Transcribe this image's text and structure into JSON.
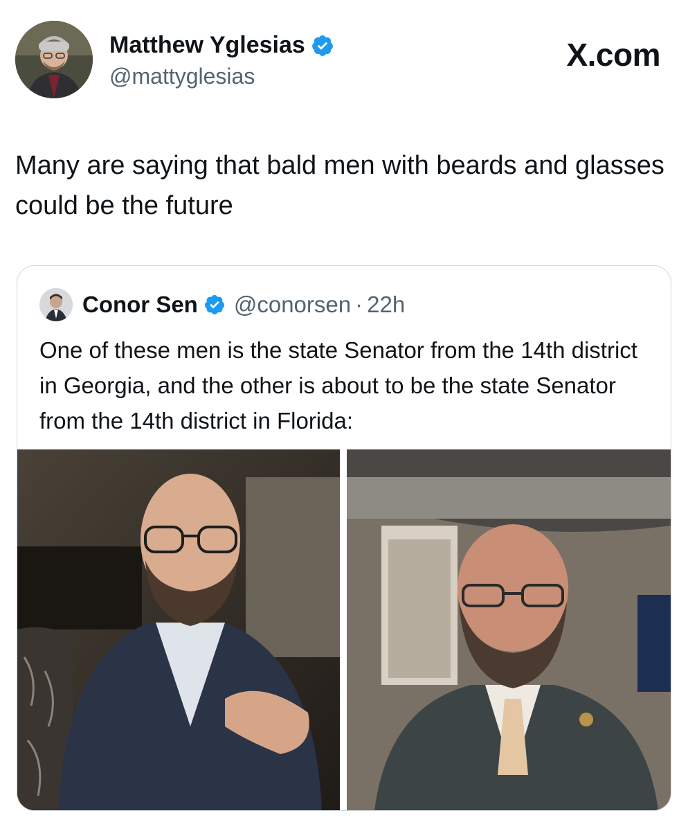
{
  "author": {
    "name": "Matthew Yglesias",
    "handle": "@mattyglesias",
    "verified_icon": "verified-badge-icon"
  },
  "brand": "X.com",
  "tweet_text": "Many are saying that bald men with beards and glasses could be the future",
  "quoted": {
    "name": "Conor Sen",
    "handle": "@conorsen",
    "separator": "·",
    "time": "22h",
    "text": "One of these men is the state Senator from the 14th district in Georgia, and the other is about to be the state Senator from the 14th district in Florida:",
    "photos": [
      "left-photo",
      "right-photo"
    ]
  },
  "colors": {
    "verified": "#1d9bf0",
    "secondary_text": "#536471",
    "border": "#cfd9de"
  }
}
